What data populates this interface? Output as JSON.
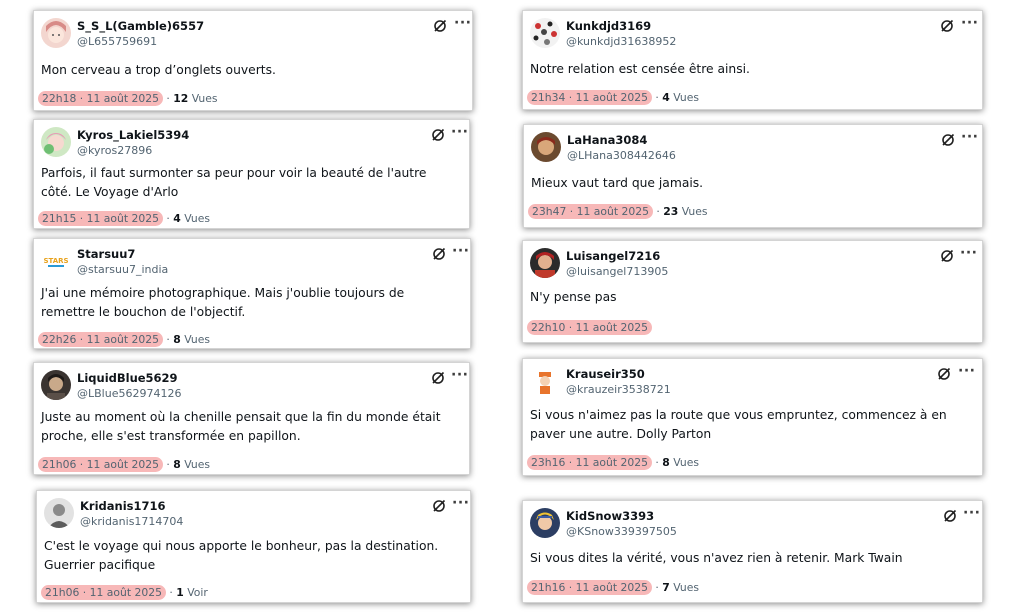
{
  "tweets": [
    {
      "name": "S_S_L(Gamble)6557",
      "handle": "@L655759691",
      "text": "Mon cerveau a trop d’onglets ouverts.",
      "time": "22h18 · 11 août 2025",
      "sep": " · ",
      "views_count": "12",
      "views_label": " Vues",
      "avatar": "pink-hair-avatar"
    },
    {
      "name": "Kyros_Lakiel5394",
      "handle": "@kyros27896",
      "text": "Parfois, il faut surmonter sa peur pour voir la beauté de l'autre côté. Le Voyage d'Arlo",
      "time": "21h15 · 11 août 2025",
      "sep": " · ",
      "views_count": "4",
      "views_label": " Vues",
      "avatar": "green-avatar"
    },
    {
      "name": "Starsuu7",
      "handle": "@starsuu7_india",
      "text": "J'ai une mémoire photographique. Mais j'oublie toujours de remettre le bouchon de l'objectif.",
      "time": "22h26 · 11 août 2025",
      "sep": " · ",
      "views_count": "8",
      "views_label": " Vues",
      "avatar": "stars-logo-avatar"
    },
    {
      "name": "LiquidBlue5629",
      "handle": "@LBlue562974126",
      "text": "Juste au moment où la chenille pensait que la fin du monde était proche, elle s'est transformée en papillon.",
      "time": "21h06 · 11 août 2025",
      "sep": " · ",
      "views_count": "8",
      "views_label": " Vues",
      "avatar": "dark-avatar"
    },
    {
      "name": "Kridanis1716",
      "handle": "@kridanis1714704",
      "text": "C'est le voyage qui nous apporte le bonheur, pas la destination. Guerrier pacifique",
      "time": "21h06 · 11 août 2025",
      "sep": " · ",
      "views_count": "1",
      "views_label": " Voir",
      "avatar": "gray-avatar"
    },
    {
      "name": "Kunkdjd3169",
      "handle": "@kunkdjd31638952",
      "text": "Notre relation est censée être ainsi.",
      "time": "21h34 · 11 août 2025",
      "sep": " · ",
      "views_count": "4",
      "views_label": " Vues",
      "avatar": "dotted-avatar"
    },
    {
      "name": "LaHana3084",
      "handle": "@LHana308442646",
      "text": "Mieux vaut tard que jamais.",
      "time": "23h47 · 11 août 2025",
      "sep": " · ",
      "views_count": "23",
      "views_label": " Vues",
      "avatar": "brown-avatar"
    },
    {
      "name": "Luisangel7216",
      "handle": "@luisangel713905",
      "text": "N'y pense pas",
      "time": "22h10 · 11 août 2025",
      "sep": "",
      "views_count": "",
      "views_label": "",
      "avatar": "red-avatar"
    },
    {
      "name": "Krauseir350",
      "handle": "@krauzeir3538721",
      "text": "Si vous n'aimez pas la route que vous empruntez, commencez à en paver une autre. Dolly Parton",
      "time": "23h16 · 11 août 2025",
      "sep": " · ",
      "views_count": "8",
      "views_label": " Vues",
      "avatar": "orange-figure-avatar"
    },
    {
      "name": "KidSnow3393",
      "handle": "@KSnow339397505",
      "text": "Si vous dites la vérité, vous n'avez rien à retenir. Mark Twain",
      "time": "21h16 · 11 août 2025",
      "sep": " · ",
      "views_count": "7",
      "views_label": " Vues",
      "avatar": "blue-avatar"
    }
  ],
  "icons": {
    "grok": "grok-icon",
    "more": "more-icon"
  },
  "more_glyph": "···",
  "colors": {
    "timestamp_highlight": "#f7b8b8",
    "text": "#0f1419",
    "muted": "#536471"
  }
}
